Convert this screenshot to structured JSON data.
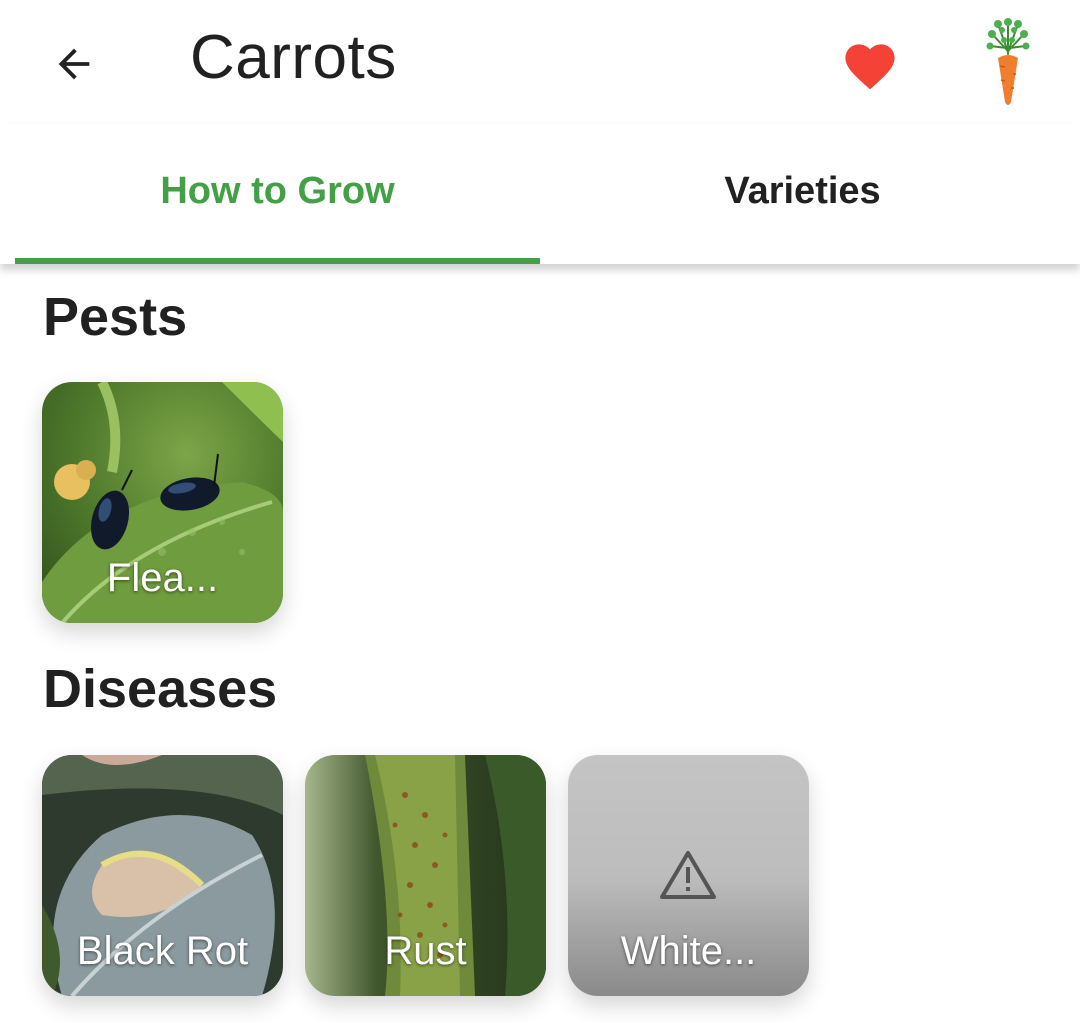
{
  "app_bar": {
    "title": "Carrots",
    "back_icon": "arrow-left-icon",
    "favorite_icon": "heart-icon",
    "plant_icon": "carrot-icon"
  },
  "tabs": [
    {
      "label": "How to Grow",
      "selected": true
    },
    {
      "label": "Varieties",
      "selected": false
    }
  ],
  "sections": {
    "pests": {
      "title": "Pests",
      "items": [
        {
          "label": "Flea...",
          "image": "flea beetles on leaf"
        }
      ]
    },
    "diseases": {
      "title": "Diseases",
      "items": [
        {
          "label": "Black Rot",
          "image": "leaf with black rot"
        },
        {
          "label": "Rust",
          "image": "leaf with rust spots"
        },
        {
          "label": "White...",
          "image": "warning-icon"
        }
      ]
    }
  },
  "colors": {
    "accent": "#43a047",
    "favorite": "#f44336",
    "text": "#212121"
  }
}
